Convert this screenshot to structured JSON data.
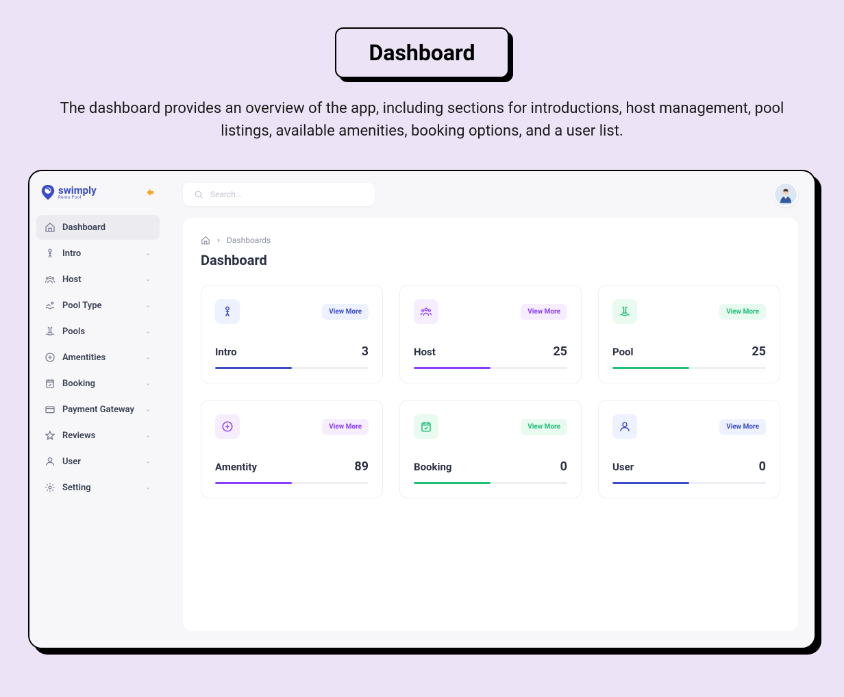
{
  "header": {
    "title": "Dashboard",
    "description": "The dashboard provides an overview of the app, including sections for introductions, host management, pool listings, available amenities, booking options, and a user list."
  },
  "logo": {
    "name": "swimply",
    "tagline": "Rents Pool"
  },
  "search": {
    "placeholder": "Search..."
  },
  "sidebar": {
    "items": [
      {
        "label": "Dashboard",
        "icon": "home-icon",
        "active": true,
        "expandable": false
      },
      {
        "label": "Intro",
        "icon": "person-icon",
        "active": false,
        "expandable": true
      },
      {
        "label": "Host",
        "icon": "group-icon",
        "active": false,
        "expandable": true
      },
      {
        "label": "Pool Type",
        "icon": "swim-icon",
        "active": false,
        "expandable": true
      },
      {
        "label": "Pools",
        "icon": "ladder-icon",
        "active": false,
        "expandable": true
      },
      {
        "label": "Amentities",
        "icon": "plus-circle-icon",
        "active": false,
        "expandable": true
      },
      {
        "label": "Booking",
        "icon": "calendar-check-icon",
        "active": false,
        "expandable": true
      },
      {
        "label": "Payment Gateway",
        "icon": "credit-card-icon",
        "active": false,
        "expandable": true
      },
      {
        "label": "Reviews",
        "icon": "star-icon",
        "active": false,
        "expandable": true
      },
      {
        "label": "User",
        "icon": "user-icon",
        "active": false,
        "expandable": true
      },
      {
        "label": "Setting",
        "icon": "gear-icon",
        "active": false,
        "expandable": true
      }
    ]
  },
  "breadcrumb": {
    "current": "Dashboards"
  },
  "page": {
    "title": "Dashboard"
  },
  "cards": [
    {
      "label": "Intro",
      "value": "3",
      "view_more": "View More",
      "color": "blue",
      "icon": "person-icon"
    },
    {
      "label": "Host",
      "value": "25",
      "view_more": "View More",
      "color": "purple",
      "icon": "group-icon"
    },
    {
      "label": "Pool",
      "value": "25",
      "view_more": "View More",
      "color": "green",
      "icon": "ladder-icon"
    },
    {
      "label": "Amentity",
      "value": "89",
      "view_more": "View More",
      "color": "purple",
      "icon": "plus-circle-icon"
    },
    {
      "label": "Booking",
      "value": "0",
      "view_more": "View More",
      "color": "green",
      "icon": "calendar-check-icon"
    },
    {
      "label": "User",
      "value": "0",
      "view_more": "View More",
      "color": "blue",
      "icon": "user-icon"
    }
  ]
}
